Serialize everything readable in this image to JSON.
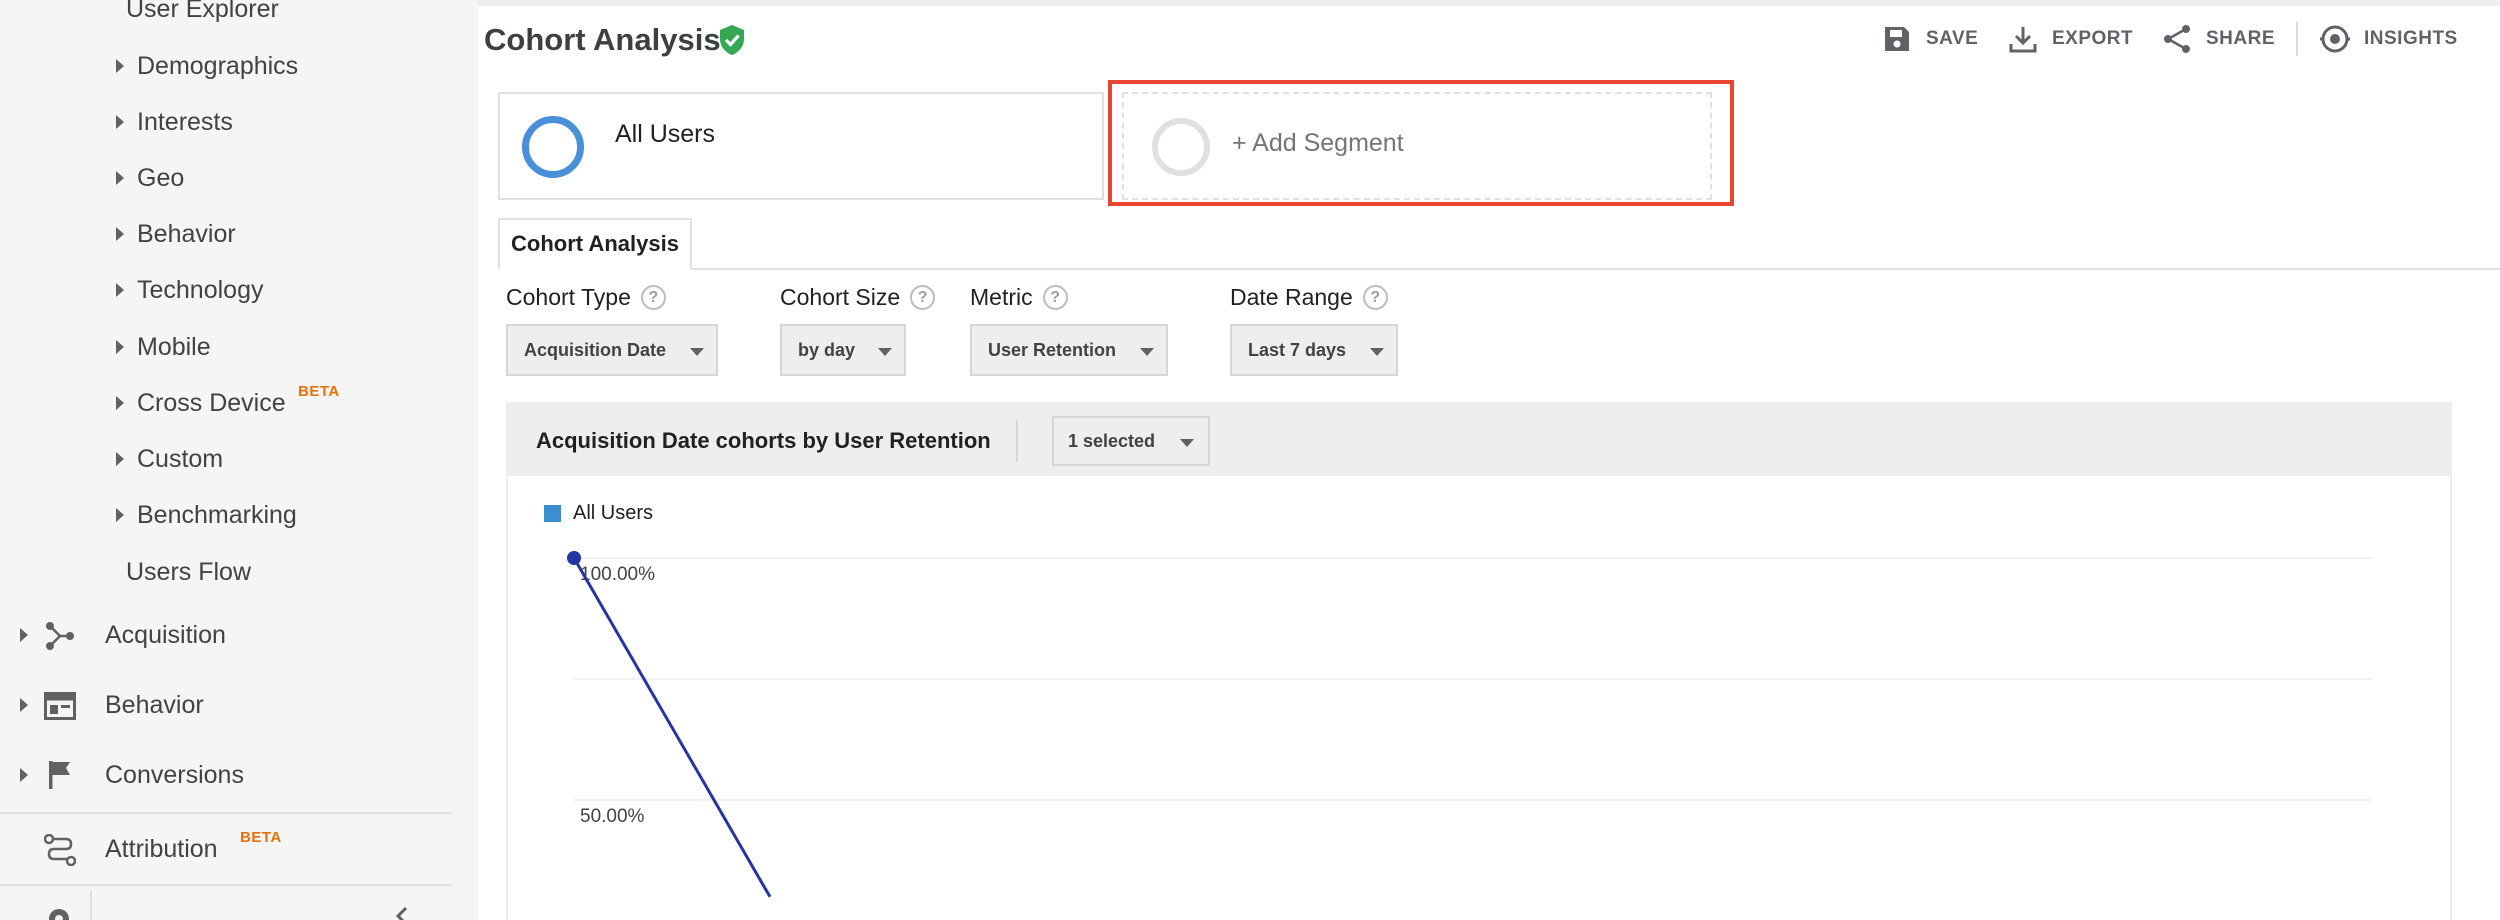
{
  "sidebar": {
    "top_partial": "User Explorer",
    "audience_items": [
      {
        "label": "Demographics"
      },
      {
        "label": "Interests"
      },
      {
        "label": "Geo"
      },
      {
        "label": "Behavior"
      },
      {
        "label": "Technology"
      },
      {
        "label": "Mobile"
      },
      {
        "label": "Cross Device",
        "badge": "BETA"
      },
      {
        "label": "Custom"
      },
      {
        "label": "Benchmarking"
      }
    ],
    "users_flow": "Users Flow",
    "sections": [
      {
        "label": "Acquisition",
        "icon": "acquisition-icon"
      },
      {
        "label": "Behavior",
        "icon": "behavior-icon"
      },
      {
        "label": "Conversions",
        "icon": "flag-icon"
      },
      {
        "label": "Attribution",
        "icon": "attribution-icon",
        "badge": "BETA"
      }
    ]
  },
  "header": {
    "title": "Cohort Analysis",
    "verified_icon": "shield-check-icon",
    "actions": {
      "save": "SAVE",
      "export": "EXPORT",
      "share": "SHARE",
      "insights": "INSIGHTS"
    }
  },
  "segments": {
    "active": "All Users",
    "add": "+ Add Segment"
  },
  "tabs": [
    {
      "label": "Cohort Analysis"
    }
  ],
  "filters": {
    "cohort_type": {
      "label": "Cohort Type",
      "value": "Acquisition Date"
    },
    "cohort_size": {
      "label": "Cohort Size",
      "value": "by day"
    },
    "metric": {
      "label": "Metric",
      "value": "User Retention"
    },
    "date_range": {
      "label": "Date Range",
      "value": "Last 7 days"
    }
  },
  "help_glyph": "?",
  "colors": {
    "accent_blue": "#4a90d9",
    "line_blue": "#2336a4",
    "highlight_red": "#e8462f",
    "beta_orange": "#e8710a",
    "verified_green": "#34a853"
  },
  "chart_data": {
    "type": "line",
    "title": "Acquisition Date cohorts by User Retention",
    "series_selector": "1 selected",
    "legend": [
      "All Users"
    ],
    "y_tick_labels": [
      "100.00%",
      "50.00%"
    ],
    "ylim": [
      0,
      100
    ],
    "series": [
      {
        "name": "All Users",
        "values": [
          100,
          30
        ]
      }
    ]
  }
}
